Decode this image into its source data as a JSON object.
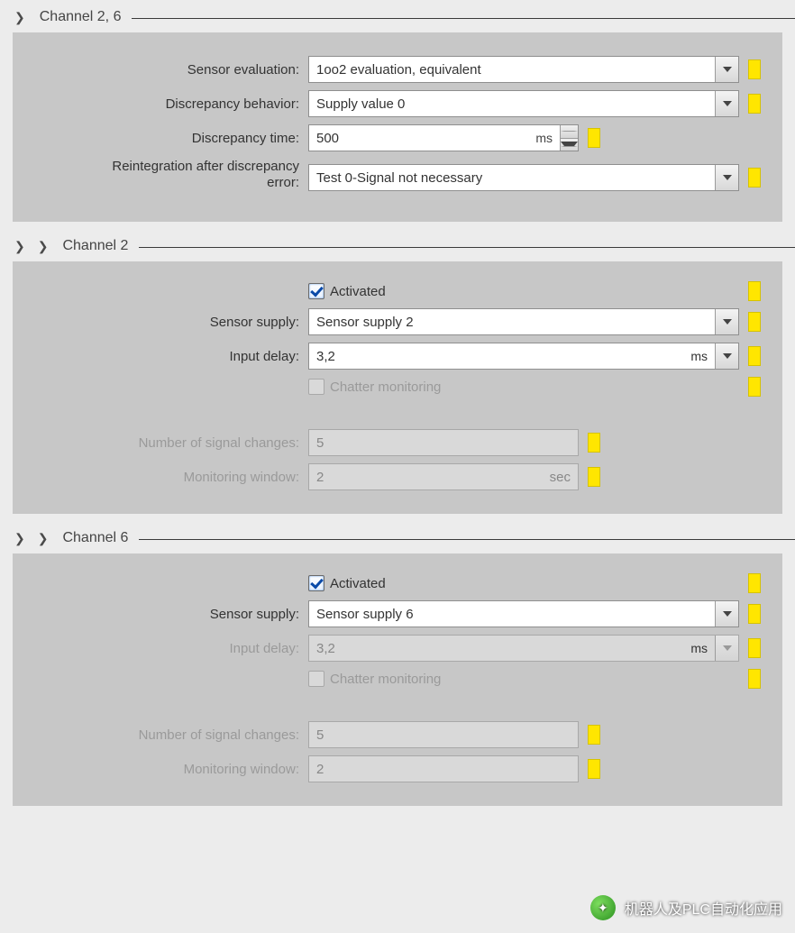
{
  "sections": {
    "s1": {
      "title": "Channel 2, 6",
      "sensor_evaluation_label": "Sensor evaluation:",
      "sensor_evaluation_value": "1oo2 evaluation, equivalent",
      "discrepancy_behavior_label": "Discrepancy behavior:",
      "discrepancy_behavior_value": "Supply value 0",
      "discrepancy_time_label": "Discrepancy time:",
      "discrepancy_time_value": "500",
      "discrepancy_time_unit": "ms",
      "reintegration_label_l1": "Reintegration after discrepancy",
      "reintegration_label_l2": "error:",
      "reintegration_value": "Test 0-Signal not necessary"
    },
    "s2": {
      "title": "Channel 2",
      "activated_label": "Activated",
      "activated_checked": true,
      "sensor_supply_label": "Sensor supply:",
      "sensor_supply_value": "Sensor supply 2",
      "input_delay_label": "Input delay:",
      "input_delay_value": "3,2",
      "input_delay_unit": "ms",
      "input_delay_disabled": false,
      "chatter_label": "Chatter monitoring",
      "chatter_checked": false,
      "signal_changes_label": "Number of signal changes:",
      "signal_changes_value": "5",
      "monitoring_window_label": "Monitoring window:",
      "monitoring_window_value": "2",
      "monitoring_window_unit": "sec"
    },
    "s3": {
      "title": "Channel 6",
      "activated_label": "Activated",
      "activated_checked": true,
      "sensor_supply_label": "Sensor supply:",
      "sensor_supply_value": "Sensor supply 6",
      "input_delay_label": "Input delay:",
      "input_delay_value": "3,2",
      "input_delay_unit": "ms",
      "input_delay_disabled": true,
      "chatter_label": "Chatter monitoring",
      "chatter_checked": false,
      "signal_changes_label": "Number of signal changes:",
      "signal_changes_value": "5",
      "monitoring_window_label": "Monitoring window:",
      "monitoring_window_value": "2",
      "monitoring_window_unit": ""
    }
  },
  "watermark": "机器人及PLC自动化应用"
}
